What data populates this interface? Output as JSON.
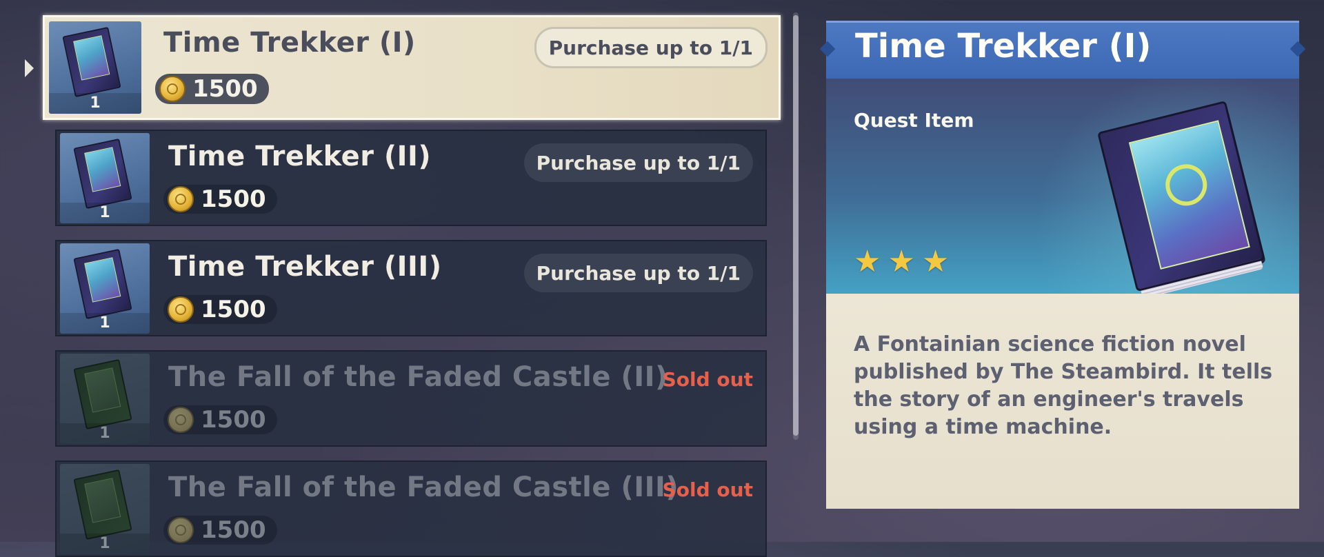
{
  "shop": {
    "items": [
      {
        "name": "Time Trekker (I)",
        "qty": "1",
        "price": "1500",
        "limit": "Purchase up to 1/1",
        "state": "selected"
      },
      {
        "name": "Time Trekker (II)",
        "qty": "1",
        "price": "1500",
        "limit": "Purchase up to 1/1",
        "state": "available"
      },
      {
        "name": "Time Trekker (III)",
        "qty": "1",
        "price": "1500",
        "limit": "Purchase up to 1/1",
        "state": "available"
      },
      {
        "name": "The Fall of the Faded Castle (II)",
        "qty": "1",
        "price": "1500",
        "limit": "Sold out",
        "state": "sold_out"
      },
      {
        "name": "The Fall of the Faded Castle (III)",
        "qty": "1",
        "price": "1500",
        "limit": "Sold out",
        "state": "sold_out"
      }
    ],
    "currency_icon": "mora-coin-icon"
  },
  "detail": {
    "title": "Time Trekker (I)",
    "type": "Quest Item",
    "rarity": 3,
    "description": "A Fontainian science fiction novel published by The Steambird. It tells the story of an engineer's travels using a time machine."
  },
  "colors": {
    "header_blue": "#3d68b4",
    "sold_out_red": "#e8604a",
    "star_gold": "#f5c842",
    "selected_bg": "#ece5d2"
  }
}
